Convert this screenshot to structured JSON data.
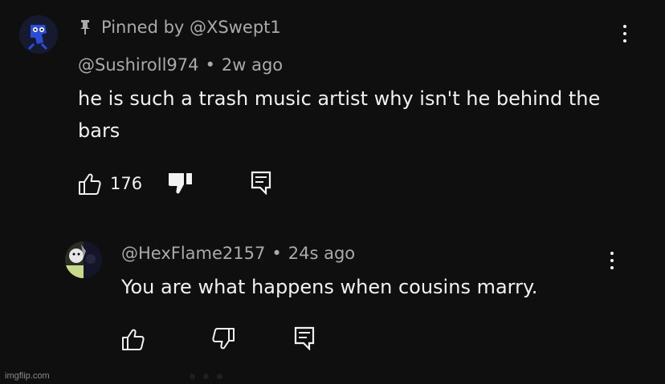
{
  "pinned": {
    "label": "Pinned by @XSwept1"
  },
  "comment": {
    "author": "@Sushiroll974",
    "time": "2w ago",
    "text": "he is such a trash music artist why isn't he behind the bars",
    "likes": "176"
  },
  "reply": {
    "author": "@HexFlame2157",
    "time": "24s ago",
    "text": "You are what happens when cousins marry."
  },
  "separator": "•",
  "watermark": "imgflip.com",
  "icons": {
    "pin": "pin-icon",
    "like": "thumbs-up-icon",
    "dislike": "thumbs-down-icon",
    "reply": "reply-icon",
    "more": "more-vertical-icon"
  },
  "colors": {
    "background": "#0f0f0f",
    "text": "#f1f1f1",
    "secondary_text": "#aaaaaa",
    "avatar_blue": "#2b4dd6"
  }
}
